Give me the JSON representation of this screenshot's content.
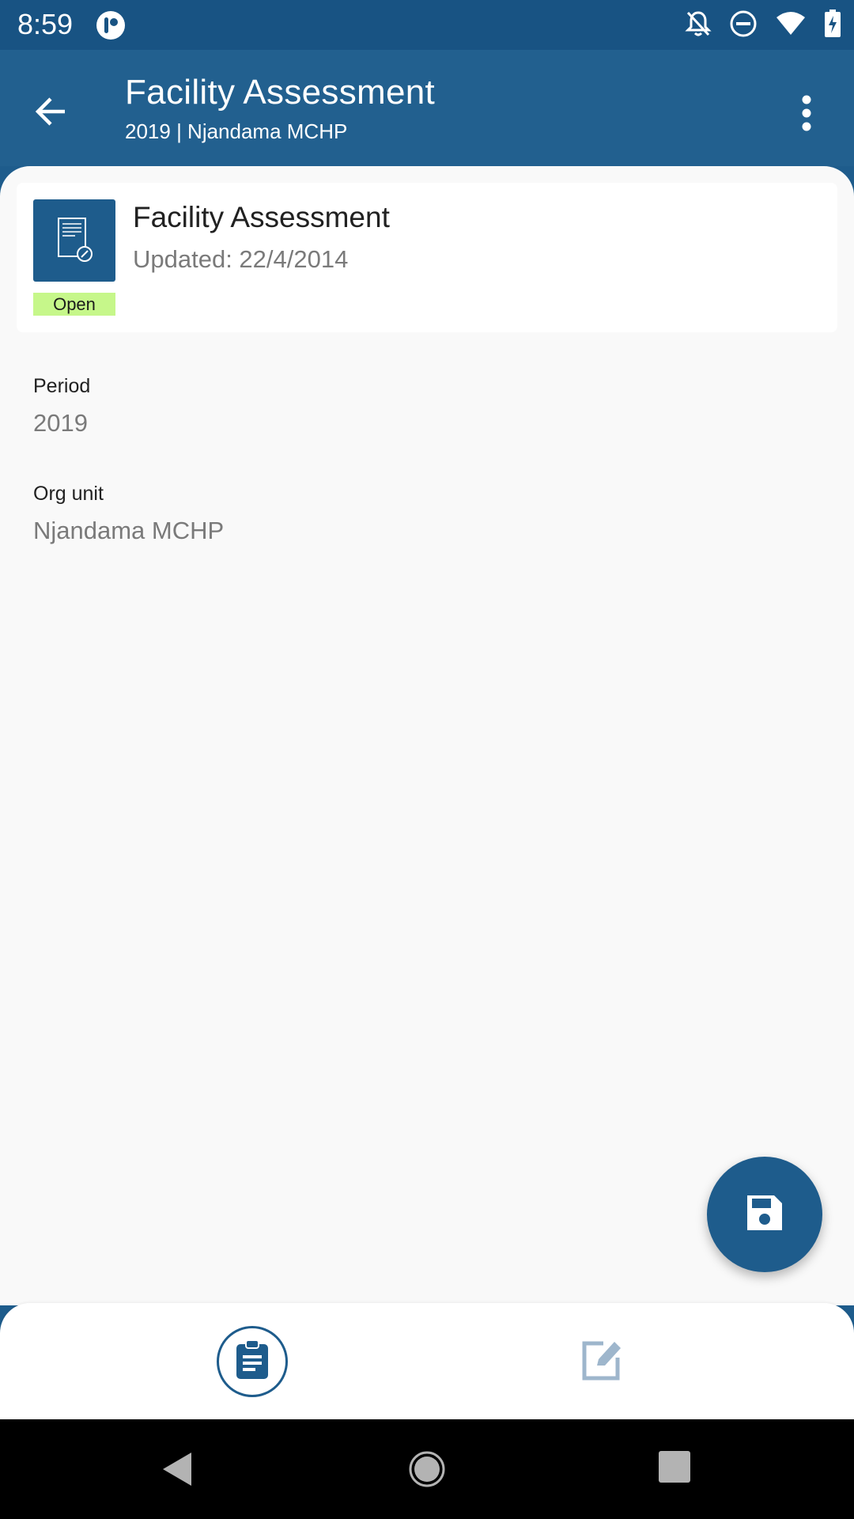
{
  "status_bar": {
    "time": "8:59",
    "icons": [
      "app-notification-icon",
      "notifications-off-icon",
      "do-not-disturb-icon",
      "wifi-icon",
      "battery-charging-icon"
    ]
  },
  "app_bar": {
    "title": "Facility Assessment",
    "subtitle": "2019 | Njandama MCHP",
    "back_icon": "arrow-back-icon",
    "menu_icon": "more-vertical-icon"
  },
  "card": {
    "title": "Facility Assessment",
    "updated": "Updated: 22/4/2014",
    "status": "Open",
    "icon": "document-edit-icon"
  },
  "fields": [
    {
      "label": "Period",
      "value": "2019"
    },
    {
      "label": "Org unit",
      "value": "Njandama MCHP"
    }
  ],
  "fab": {
    "icon": "save-icon"
  },
  "bottom_nav": {
    "items": [
      {
        "icon": "clipboard-details-icon",
        "selected": true
      },
      {
        "icon": "edit-form-icon",
        "selected": false
      }
    ]
  },
  "colors": {
    "primary": "#1E5C8C",
    "status_bar": "#185383",
    "badge_open": "#C6F78A",
    "background": "#F9F9F9"
  }
}
